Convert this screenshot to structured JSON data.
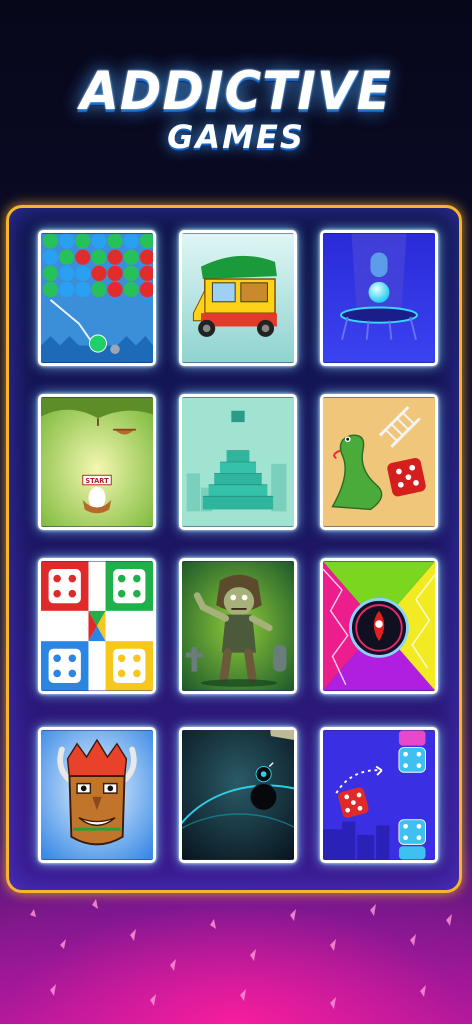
{
  "header": {
    "title": "ADDICTIVE",
    "subtitle": "GAMES"
  },
  "games": [
    {
      "icon": "bubble-shooter-icon"
    },
    {
      "icon": "auto-rickshaw-icon"
    },
    {
      "icon": "bouncing-ball-trampoline-icon"
    },
    {
      "icon": "egg-drop-icon",
      "label": "START"
    },
    {
      "icon": "block-tower-icon"
    },
    {
      "icon": "snakes-ladders-icon"
    },
    {
      "icon": "ludo-board-icon"
    },
    {
      "icon": "zombie-icon"
    },
    {
      "icon": "color-switch-icon"
    },
    {
      "icon": "tribal-mask-icon"
    },
    {
      "icon": "space-jump-icon"
    },
    {
      "icon": "dice-merge-icon"
    }
  ],
  "colors": {
    "panel_border": "#f6b52a",
    "accent_pink": "#e4208f",
    "tile_border": "#ffffff"
  }
}
